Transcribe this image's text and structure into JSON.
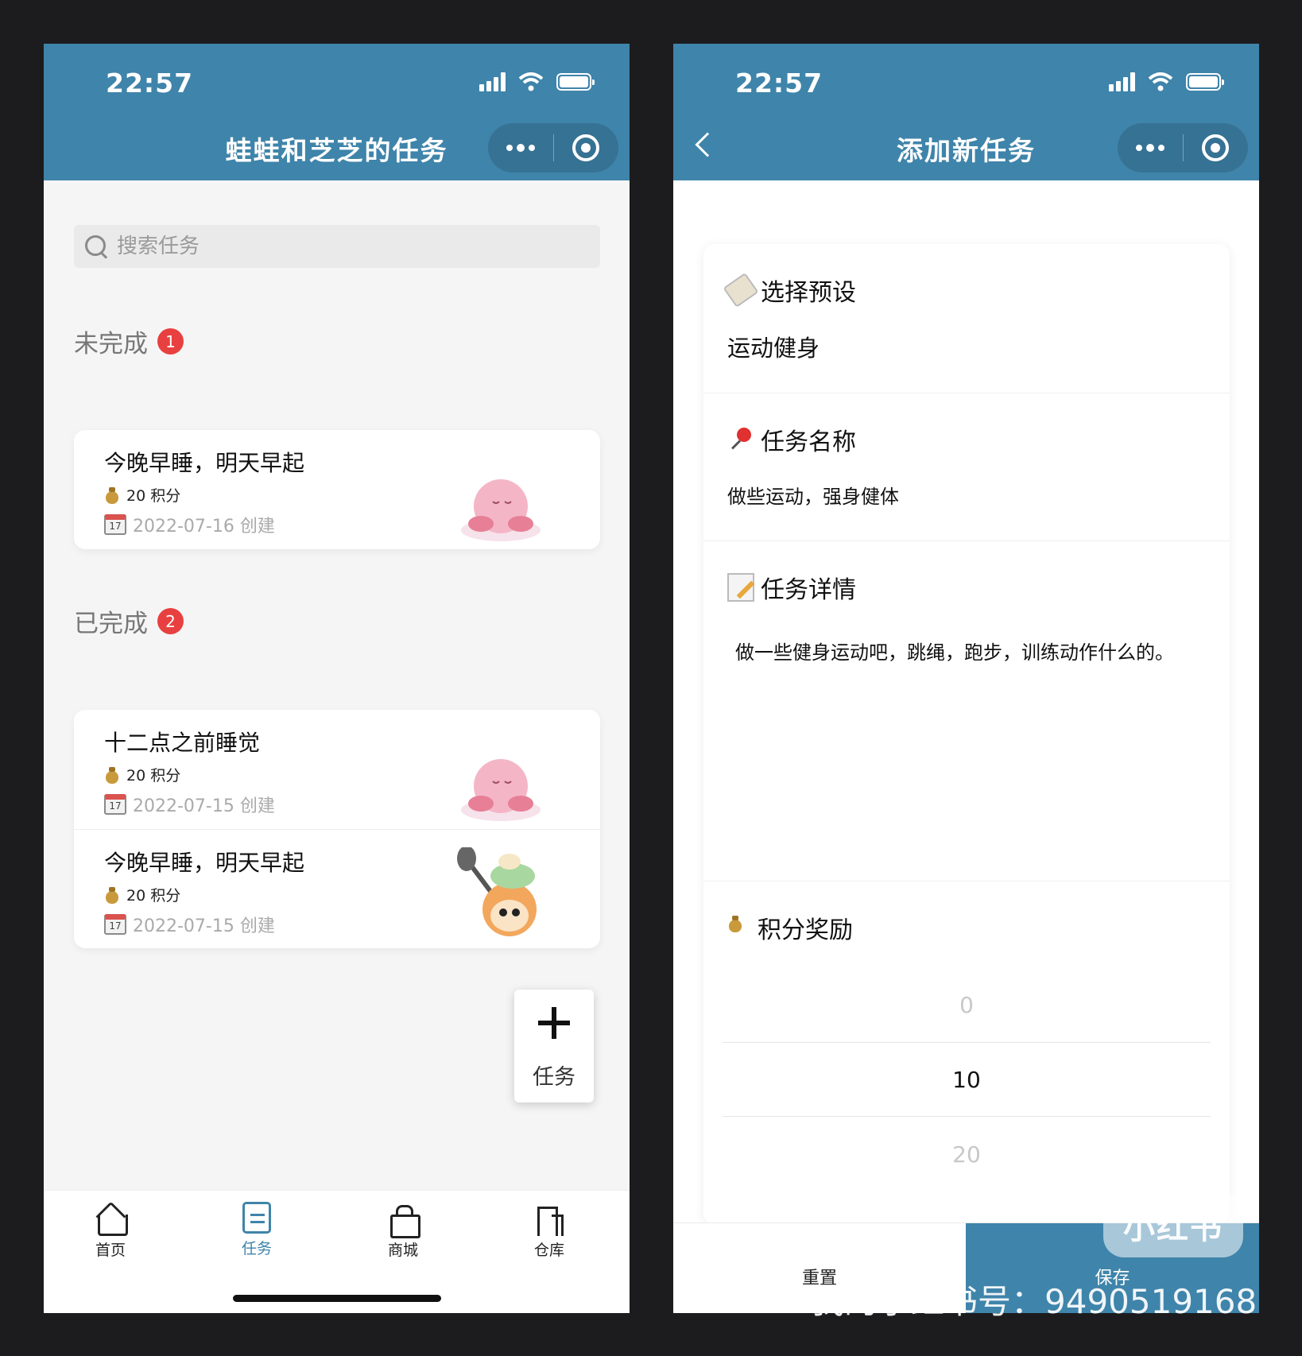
{
  "left": {
    "status": {
      "time": "22:57"
    },
    "nav": {
      "title": "蛙蛙和芝芝的任务"
    },
    "search": {
      "placeholder": "搜索任务"
    },
    "incomplete": {
      "title": "未完成",
      "count": "1"
    },
    "completed": {
      "title": "已完成",
      "count": "2"
    },
    "tasks_incomplete": [
      {
        "name": "今晚早睡，明天早起",
        "points": "20 积分",
        "date": "2022-07-16 创建",
        "mascot": "pink-puff-on-cloud"
      }
    ],
    "tasks_completed": [
      {
        "name": "十二点之前睡觉",
        "points": "20 积分",
        "date": "2022-07-15 创建",
        "mascot": "pink-puff-on-cloud"
      },
      {
        "name": "今晚早睡，明天早起",
        "points": "20 积分",
        "date": "2022-07-15 创建",
        "mascot": "chef-with-frying-pan"
      }
    ],
    "calendar_day": "17",
    "fab": {
      "label": "任务",
      "icon": "plus-icon"
    },
    "tabbar": [
      {
        "label": "首页",
        "icon": "home-icon",
        "active": false
      },
      {
        "label": "任务",
        "icon": "document-icon",
        "active": true
      },
      {
        "label": "商城",
        "icon": "gift-icon",
        "active": false
      },
      {
        "label": "仓库",
        "icon": "building-icon",
        "active": false
      }
    ]
  },
  "right": {
    "status": {
      "time": "22:57"
    },
    "nav": {
      "title": "添加新任务"
    },
    "preset": {
      "label": "选择预设",
      "value": "运动健身"
    },
    "name": {
      "label": "任务名称",
      "value": "做些运动，强身健体"
    },
    "detail": {
      "label": "任务详情",
      "value": "做一些健身运动吧，跳绳，跑步，训练动作什么的。"
    },
    "reward": {
      "label": "积分奖励",
      "options": [
        "0",
        "10",
        "20"
      ],
      "selected": "10"
    },
    "buttons": {
      "reset": "重置",
      "save": "保存"
    }
  },
  "watermark": {
    "logo": "小红书",
    "text": "我的小红书号：9490519168"
  },
  "colors": {
    "brand": "#3f84aa",
    "badge": "#e84040",
    "background": "#1c1c1e"
  }
}
